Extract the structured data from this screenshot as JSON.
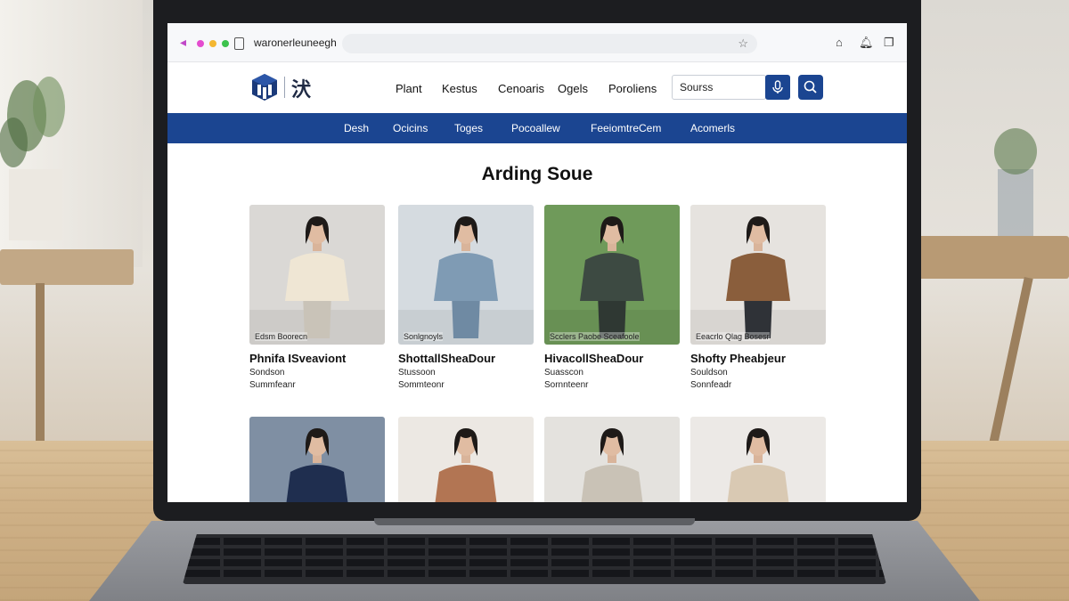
{
  "browser": {
    "url": "waronerleuneegh",
    "colors": {
      "close": "#e44ccf",
      "min": "#f4b731",
      "max": "#3cc24c"
    }
  },
  "site": {
    "nav": [
      "Plant",
      "Kestus",
      "Cenoaris",
      "Ogels",
      "Poroliens"
    ],
    "search_placeholder": "Sourss",
    "logo_glyph": "汱",
    "categories": [
      "Desh",
      "Ocicins",
      "Toges",
      "Pocoallew",
      "FeeiomtreCem",
      "Acomerls"
    ]
  },
  "main": {
    "title": "Arding Soue",
    "products": [
      {
        "caption": "Edsm Boorecn",
        "title": "Phnifa ISveaviont",
        "sub": "Sondson",
        "sub2": "Summfeanr",
        "bg": "#dad8d5",
        "top": "#efe6d4",
        "bottom": "#c9c3b8"
      },
      {
        "caption": "Sonlgnoyls",
        "title": "ShottallSheaDour",
        "sub": "Stussoon",
        "sub2": "Sommteonr",
        "bg": "#d5dbe0",
        "top": "#7f9bb4",
        "bottom": "#6f8aa3"
      },
      {
        "caption": "Scclers Paobe Sceafoole",
        "title": "HivacollSheaDour",
        "sub": "Suasscon",
        "sub2": "Sornnteenr",
        "bg": "#6f9a5a",
        "top": "#3d4a42",
        "bottom": "#2f3833"
      },
      {
        "caption": "Eeacrlo Qlag Bosesr",
        "title": "Shofty Pheabjeur",
        "sub": "Souldson",
        "sub2": "Sonnfeadr",
        "bg": "#e6e3df",
        "top": "#8a5e3c",
        "bottom": "#2f3237"
      },
      {
        "caption": "",
        "title": "",
        "sub": "",
        "sub2": "",
        "bg": "#7f8fa3",
        "top": "#1f2e4f",
        "bottom": "#1f2e4f"
      },
      {
        "caption": "",
        "title": "",
        "sub": "",
        "sub2": "",
        "bg": "#ece8e3",
        "top": "#b27553",
        "bottom": "#b27553"
      },
      {
        "caption": "",
        "title": "",
        "sub": "",
        "sub2": "",
        "bg": "#e4e2de",
        "top": "#c9c2b6",
        "bottom": "#c9c2b6"
      },
      {
        "caption": "",
        "title": "",
        "sub": "",
        "sub2": "",
        "bg": "#ece9e6",
        "top": "#d9c9b3",
        "bottom": "#d9c9b3"
      }
    ]
  }
}
